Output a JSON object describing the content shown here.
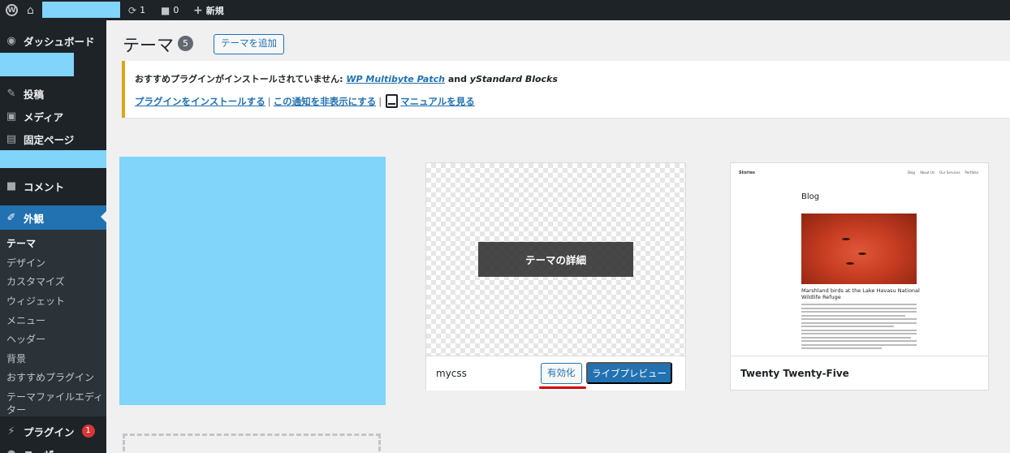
{
  "adminbar": {
    "updates_count": "1",
    "comments_count": "0",
    "new_label": "新規"
  },
  "sidebar": {
    "dashboard": "ダッシュボード",
    "posts": "投稿",
    "media": "メディア",
    "pages": "固定ページ",
    "comments": "コメント",
    "appearance": "外観",
    "submenu": [
      "テーマ",
      "デザイン",
      "カスタマイズ",
      "ウィジェット",
      "メニュー",
      "ヘッダー",
      "背景",
      "おすすめプラグイン",
      "テーマファイルエディ",
      "ター"
    ],
    "plugins": "プラグイン",
    "plugins_badge": "1",
    "users_partial": "ユーザー"
  },
  "page": {
    "title": "テーマ",
    "count": "5",
    "add_button": "テーマを追加"
  },
  "notice": {
    "line1_prefix": "おすすめプラグインがインストールされていません:",
    "plugin1": "WP Multibyte Patch",
    "and": "and",
    "plugin2": "yStandard Blocks",
    "install_link": "プラグインをインストールする",
    "dismiss_link": "この通知を非表示にする",
    "manual_link": "マニュアルを見る",
    "sep": "|"
  },
  "themes": [
    {
      "name": "mycss",
      "details_button": "テーマの詳細",
      "activate_button": "有効化",
      "preview_button": "ライブプレビュー"
    },
    {
      "name": "Twenty Twenty-Five",
      "preview": {
        "site": "Stories",
        "nav": [
          "Blog",
          "About Us",
          "Our Services",
          "Portfolio"
        ],
        "blog_title": "Blog",
        "post_title": "Marshland birds at the Lake Havasu National Wildlife Refuge"
      }
    }
  ],
  "colors": {
    "admin_dark": "#1d2327",
    "accent_blue": "#2271b1",
    "redacted": "#81d4fa",
    "notice_border": "#dba617",
    "badge_red": "#d63638",
    "annotation_red": "#d20000"
  }
}
